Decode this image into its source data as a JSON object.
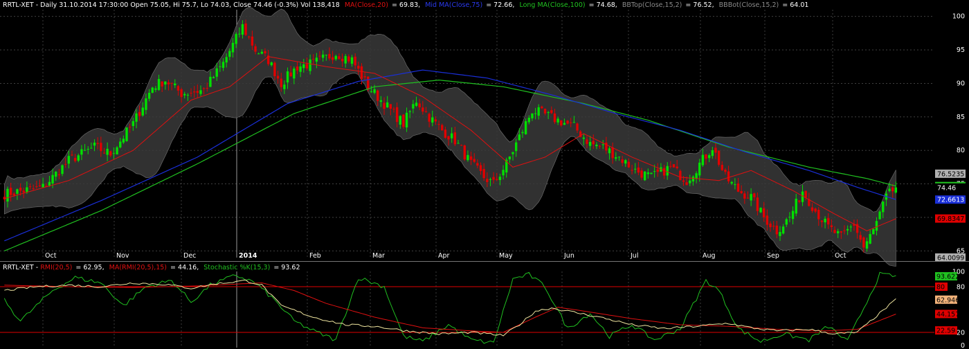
{
  "main_header": {
    "prefix": "RRTL-XET - Daily 31.10.2014 17:30:00 Open 75.05, Hi 75.7, Lo 74.03, Close 74.46 (-0.3%) Vol 138,418",
    "ma_label": "MA(Close,20)",
    "ma_value": "= 69.83,",
    "mid_label": "Mid MA(Close,75)",
    "mid_value": "= 72.66,",
    "long_label": "Long MA(Close,100)",
    "long_value": "= 74.68,",
    "bbtop_label": "BBTop(Close,15,2)",
    "bbtop_value": "= 76.52,",
    "bbbot_label": "BBBot(Close,15,2)",
    "bbbot_value": "= 64.01"
  },
  "sub_header": {
    "prefix": "RRTL-XET - ",
    "rmi_label": "RMI(20,5)",
    "rmi_value": "= 62.95,",
    "marmi_label": "MA(RMI(20,5),15)",
    "marmi_value": "= 44.16,",
    "stoch_label": "Stochastic %K(15,3)",
    "stoch_value": "= 93.62"
  },
  "colors": {
    "background": "#000000",
    "grid": "#4a4a4a",
    "up_candle": "#00e000",
    "down_candle": "#e00000",
    "band_fill": "#3a3a3a",
    "ma20": "#e01010",
    "ma75": "#1a2fd8",
    "ma100": "#20c020",
    "rmi": "#f0e6a0",
    "stoch": "#20c020",
    "ref_line": "#e00000"
  },
  "chart_data": [
    {
      "type": "candlestick",
      "title": "RRTL-XET - Daily",
      "x_tick_labels": [
        "Oct",
        "Nov",
        "Dec",
        "2014",
        "Feb",
        "Mar",
        "Apr",
        "May",
        "Jun",
        "Jul",
        "Aug",
        "Sep",
        "Oct"
      ],
      "ylim": [
        64,
        101
      ],
      "y_ticks": [
        65,
        70,
        75,
        80,
        85,
        90,
        95,
        100
      ],
      "grid": true,
      "price_keypoints": {
        "description": "approximate closing price path, [bar_index, price]",
        "points": [
          [
            0,
            73.5
          ],
          [
            12,
            74.5
          ],
          [
            20,
            78.5
          ],
          [
            28,
            80.5
          ],
          [
            33,
            79.5
          ],
          [
            40,
            84
          ],
          [
            46,
            89.5
          ],
          [
            50,
            90.5
          ],
          [
            55,
            88.5
          ],
          [
            62,
            89
          ],
          [
            68,
            93
          ],
          [
            74,
            98.5
          ],
          [
            78,
            95
          ],
          [
            82,
            93.5
          ],
          [
            86,
            90
          ],
          [
            91,
            92.5
          ],
          [
            96,
            93
          ],
          [
            103,
            94.5
          ],
          [
            108,
            93.5
          ],
          [
            113,
            89.5
          ],
          [
            118,
            87
          ],
          [
            124,
            84
          ],
          [
            128,
            87.5
          ],
          [
            132,
            85
          ],
          [
            136,
            83
          ],
          [
            140,
            81.5
          ],
          [
            145,
            78
          ],
          [
            149,
            76
          ],
          [
            152,
            75
          ],
          [
            156,
            78
          ],
          [
            160,
            82
          ],
          [
            164,
            86
          ],
          [
            167,
            85.5
          ],
          [
            172,
            84.5
          ],
          [
            177,
            83.5
          ],
          [
            182,
            81
          ],
          [
            186,
            80.5
          ],
          [
            191,
            79
          ],
          [
            196,
            77
          ],
          [
            201,
            76
          ],
          [
            207,
            77.5
          ],
          [
            212,
            75.5
          ],
          [
            216,
            78
          ],
          [
            220,
            80.5
          ],
          [
            224,
            76
          ],
          [
            228,
            74
          ],
          [
            232,
            73
          ],
          [
            236,
            70
          ],
          [
            240,
            68
          ],
          [
            244,
            70
          ],
          [
            248,
            74
          ],
          [
            252,
            71
          ],
          [
            256,
            68.5
          ],
          [
            260,
            67
          ],
          [
            264,
            69
          ],
          [
            267,
            65.5
          ],
          [
            270,
            68
          ],
          [
            274,
            73
          ],
          [
            277,
            74.5
          ]
        ]
      },
      "series": [
        {
          "name": "MA(Close,20)",
          "last": 69.83,
          "keypoints": [
            [
              0,
              72.8
            ],
            [
              20,
              75.5
            ],
            [
              40,
              80
            ],
            [
              58,
              87.5
            ],
            [
              70,
              89.5
            ],
            [
              82,
              94
            ],
            [
              100,
              92.5
            ],
            [
              115,
              91.5
            ],
            [
              130,
              88
            ],
            [
              145,
              83
            ],
            [
              158,
              77.5
            ],
            [
              168,
              79
            ],
            [
              180,
              82.5
            ],
            [
              195,
              79
            ],
            [
              210,
              76
            ],
            [
              222,
              75.5
            ],
            [
              232,
              77
            ],
            [
              245,
              74
            ],
            [
              258,
              70.5
            ],
            [
              268,
              68
            ],
            [
              277,
              69.8
            ]
          ]
        },
        {
          "name": "Mid MA(Close,75)",
          "last": 72.66,
          "keypoints": [
            [
              0,
              66.5
            ],
            [
              30,
              72.5
            ],
            [
              60,
              79
            ],
            [
              88,
              87
            ],
            [
              110,
              90.3
            ],
            [
              130,
              92
            ],
            [
              150,
              90.8
            ],
            [
              170,
              88.3
            ],
            [
              190,
              85.5
            ],
            [
              210,
              83
            ],
            [
              230,
              79.8
            ],
            [
              250,
              77
            ],
            [
              265,
              74.5
            ],
            [
              277,
              72.66
            ]
          ]
        },
        {
          "name": "Long MA(Close,100)",
          "last": 74.68,
          "keypoints": [
            [
              0,
              65
            ],
            [
              30,
              71
            ],
            [
              60,
              78
            ],
            [
              90,
              85.5
            ],
            [
              115,
              89.5
            ],
            [
              135,
              90.5
            ],
            [
              155,
              89.5
            ],
            [
              180,
              87
            ],
            [
              200,
              84.5
            ],
            [
              225,
              80.5
            ],
            [
              250,
              77.5
            ],
            [
              268,
              75.8
            ],
            [
              277,
              74.68
            ]
          ]
        },
        {
          "name": "BBTop(Close,15,2)",
          "last": 76.52
        },
        {
          "name": "BBBot(Close,15,2)",
          "last": 64.01
        }
      ],
      "right_labels": [
        {
          "value": 76.52,
          "text": "76.5235",
          "color": "#b0b0b0",
          "text_color": "#000000"
        },
        {
          "value": 74.68,
          "text": "74.6821",
          "color": "#20c020",
          "text_color": "#000000"
        },
        {
          "value": 74.46,
          "text": "74.46",
          "color": "#000000",
          "text_color": "#ffffff"
        },
        {
          "value": 72.66,
          "text": "72.6613",
          "color": "#1a2fd8",
          "text_color": "#ffffff"
        },
        {
          "value": 69.83,
          "text": "69.8347",
          "color": "#e00000",
          "text_color": "#000000"
        },
        {
          "value": 64.01,
          "text": "64.0099",
          "color": "#b0b0b0",
          "text_color": "#000000"
        }
      ]
    },
    {
      "type": "line",
      "title": "RRTL-XET - RMI(20,5), MA(RMI(20,5),15), Stochastic %K(15,3)",
      "ylim": [
        0,
        100
      ],
      "y_ticks": [
        0,
        20,
        80,
        100
      ],
      "reference_lines": [
        80,
        20
      ],
      "series": [
        {
          "name": "RMI(20,5)",
          "last": 62.95,
          "keypoints": [
            [
              0,
              75
            ],
            [
              10,
              80
            ],
            [
              20,
              82
            ],
            [
              30,
              80
            ],
            [
              40,
              85
            ],
            [
              50,
              83
            ],
            [
              58,
              78
            ],
            [
              66,
              84
            ],
            [
              75,
              88
            ],
            [
              80,
              82
            ],
            [
              86,
              55
            ],
            [
              96,
              40
            ],
            [
              106,
              30
            ],
            [
              115,
              28
            ],
            [
              125,
              22
            ],
            [
              135,
              18
            ],
            [
              145,
              20
            ],
            [
              155,
              16
            ],
            [
              160,
              30
            ],
            [
              165,
              48
            ],
            [
              170,
              52
            ],
            [
              175,
              48
            ],
            [
              185,
              40
            ],
            [
              195,
              30
            ],
            [
              205,
              25
            ],
            [
              215,
              28
            ],
            [
              225,
              32
            ],
            [
              232,
              26
            ],
            [
              240,
              22
            ],
            [
              250,
              24
            ],
            [
              258,
              18
            ],
            [
              265,
              20
            ],
            [
              270,
              38
            ],
            [
              277,
              63
            ]
          ]
        },
        {
          "name": "MA(RMI(20,5),15)",
          "last": 44.16,
          "keypoints": [
            [
              0,
              82
            ],
            [
              20,
              80
            ],
            [
              40,
              79
            ],
            [
              60,
              81
            ],
            [
              80,
              85
            ],
            [
              90,
              75
            ],
            [
              100,
              58
            ],
            [
              115,
              40
            ],
            [
              130,
              26
            ],
            [
              145,
              22
            ],
            [
              155,
              20
            ],
            [
              165,
              40
            ],
            [
              172,
              53
            ],
            [
              180,
              48
            ],
            [
              195,
              38
            ],
            [
              210,
              30
            ],
            [
              225,
              28
            ],
            [
              240,
              24
            ],
            [
              255,
              22
            ],
            [
              265,
              24
            ],
            [
              277,
              44
            ]
          ]
        },
        {
          "name": "Stochastic %K(15,3)",
          "last": 93.62,
          "keypoints": [
            [
              0,
              62
            ],
            [
              5,
              35
            ],
            [
              10,
              55
            ],
            [
              15,
              75
            ],
            [
              22,
              92
            ],
            [
              30,
              85
            ],
            [
              37,
              55
            ],
            [
              44,
              80
            ],
            [
              52,
              88
            ],
            [
              58,
              60
            ],
            [
              64,
              82
            ],
            [
              72,
              95
            ],
            [
              78,
              85
            ],
            [
              84,
              62
            ],
            [
              90,
              35
            ],
            [
              96,
              22
            ],
            [
              103,
              10
            ],
            [
              110,
              92
            ],
            [
              118,
              80
            ],
            [
              124,
              15
            ],
            [
              130,
              8
            ],
            [
              138,
              30
            ],
            [
              145,
              10
            ],
            [
              152,
              6
            ],
            [
              158,
              90
            ],
            [
              163,
              96
            ],
            [
              168,
              80
            ],
            [
              175,
              25
            ],
            [
              182,
              45
            ],
            [
              188,
              15
            ],
            [
              195,
              30
            ],
            [
              202,
              10
            ],
            [
              210,
              25
            ],
            [
              218,
              88
            ],
            [
              222,
              75
            ],
            [
              228,
              25
            ],
            [
              235,
              8
            ],
            [
              242,
              18
            ],
            [
              250,
              10
            ],
            [
              256,
              28
            ],
            [
              262,
              8
            ],
            [
              267,
              52
            ],
            [
              272,
              96
            ],
            [
              277,
              93.6
            ]
          ]
        }
      ],
      "right_labels": [
        {
          "value": 93.62,
          "text": "93.6228",
          "color": "#20c020",
          "text_color": "#000000"
        },
        {
          "value": 80,
          "text": "80",
          "color": "#e00000",
          "text_color": "#000000"
        },
        {
          "value": 62.95,
          "text": "62.9464",
          "color": "#f2b27a",
          "text_color": "#000000"
        },
        {
          "value": 44.16,
          "text": "44.1578",
          "color": "#e00000",
          "text_color": "#000000"
        },
        {
          "value": 22.59,
          "text": "22.59",
          "color": "#e00000",
          "text_color": "#000000"
        }
      ]
    }
  ]
}
